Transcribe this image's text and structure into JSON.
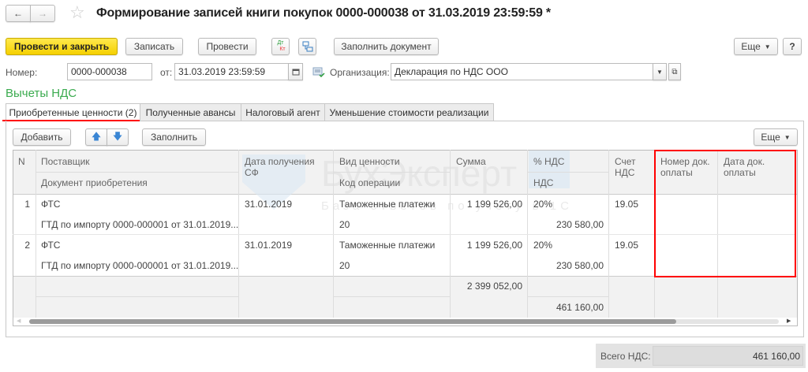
{
  "window": {
    "title": "Формирование записей книги покупок 0000-000038 от 31.03.2019 23:59:59 *"
  },
  "toolbar": {
    "post_close": "Провести и закрыть",
    "save": "Записать",
    "post": "Провести",
    "dtkt_top": "Дт",
    "dtkt_bottom": "Кт",
    "fill_doc": "Заполнить документ",
    "more": "Еще",
    "help": "?"
  },
  "header": {
    "number_label": "Номер:",
    "number_value": "0000-000038",
    "date_label": "от:",
    "date_value": "31.03.2019 23:59:59",
    "org_label": "Организация:",
    "org_value": "Декларация по НДС ООО"
  },
  "section_title": "Вычеты НДС",
  "tabs": [
    {
      "label": "Приобретенные ценности (2)"
    },
    {
      "label": "Полученные авансы"
    },
    {
      "label": "Налоговый агент"
    },
    {
      "label": "Уменьшение стоимости реализации"
    }
  ],
  "table_toolbar": {
    "add": "Добавить",
    "fill": "Заполнить",
    "more": "Еще"
  },
  "columns": {
    "n": "N",
    "supplier": "Поставщик",
    "doc": "Документ приобретения",
    "date": "Дата получения СФ",
    "kind": "Вид ценности",
    "opcode": "Код операции",
    "sum": "Сумма",
    "vat_rate": "% НДС",
    "vat": "НДС",
    "account": "Счет НДС",
    "pay_num": "Номер док. оплаты",
    "pay_date": "Дата док. оплаты"
  },
  "rows": [
    {
      "n": "1",
      "supplier": "ФТС",
      "doc": "ГТД по импорту 0000-000001 от 31.01.2019...",
      "date": "31.01.2019",
      "kind": "Таможенные платежи",
      "opcode": "20",
      "sum": "1 199 526,00",
      "vat_rate": "20%",
      "vat": "230 580,00",
      "account": "19.05",
      "pay_num": "",
      "pay_date": ""
    },
    {
      "n": "2",
      "supplier": "ФТС",
      "doc": "ГТД по импорту 0000-000001 от 31.01.2019...",
      "date": "31.01.2019",
      "kind": "Таможенные платежи",
      "opcode": "20",
      "sum": "1 199 526,00",
      "vat_rate": "20%",
      "vat": "230 580,00",
      "account": "19.05",
      "pay_num": "",
      "pay_date": ""
    }
  ],
  "totals": {
    "sum": "2 399 052,00",
    "vat": "461 160,00"
  },
  "footer": {
    "total_vat_label": "Всего НДС:",
    "total_vat_value": "461 160,00"
  },
  "watermark": {
    "brand": "БухЭксперт 8",
    "tagline": "База ответов по учету в 1С"
  },
  "colors": {
    "accent_yellow": "#f5d000",
    "section_green": "#3bab4f",
    "highlight_red": "#ff0000"
  }
}
